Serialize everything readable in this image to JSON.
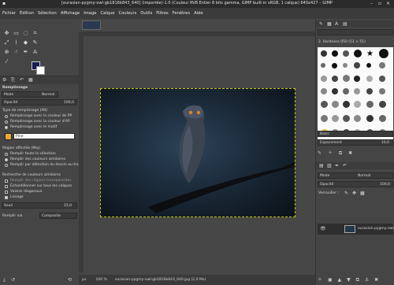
{
  "window": {
    "title": "[eurasian-pygmy-owl-gb1816b843_640] (importée)-1.0 (Couleur RVB Entier 8 bits gamma, GIMP built-in sRGB, 1 calque) 640x427 – GIMP"
  },
  "menu": [
    "Fichier",
    "Édition",
    "Sélection",
    "Affichage",
    "Image",
    "Calque",
    "Couleurs",
    "Outils",
    "Filtres",
    "Fenêtres",
    "Aide"
  ],
  "tool_options": {
    "title": "Remplissage",
    "mode_label": "Mode",
    "mode_value": "Normal",
    "opacity_label": "Opacité",
    "opacity_value": "100,0",
    "fill_type_label": "Type de remplissage (Alt)",
    "fill_fg": "Remplissage avec la couleur de PP",
    "fill_bg": "Remplissage avec la couleur d'AP",
    "fill_pattern": "Remplissage avec le motif",
    "pattern_name": "Pine",
    "affected_label": "Région affectée (Maj)",
    "aff_selection": "Remplir toute la sélection",
    "aff_similar": "Remplir des couleurs similaires",
    "aff_lineart": "Remplir par détection du dessin au trait",
    "similar_label": "Recherche de couleurs similaires",
    "sim_transparent": "Remplir des régions transparentes",
    "sim_merged": "Échantillonner sur tous les calques",
    "sim_diagonal": "Voisins diagonaux",
    "sim_antialias": "Lissage",
    "threshold_label": "Seuil",
    "threshold_value": "15,0",
    "fillby_label": "Remplir via",
    "fillby_value": "Composite"
  },
  "status": {
    "unit": "px",
    "zoom": "100 %",
    "info": "eurasian-pygmy-owl-gb1816b843_640.jpg (2,0 Mo)"
  },
  "brushes": {
    "title": "2. Hardness 050 (51 × 51)",
    "tag": "Basic",
    "spacing_label": "Espacement",
    "spacing_value": "10,0"
  },
  "layers": {
    "mode_label": "Mode",
    "mode_value": "Normal",
    "opacity_label": "Opacité",
    "opacity_value": "100,0",
    "lock_label": "Verrouiller :",
    "layer_name": "eurasian-pygmy-owl"
  },
  "colors": {
    "foreground": "#1a1a5a",
    "background": "#ffffff",
    "pattern_swatch": "#f0a830",
    "selection_border": "#c8c800"
  }
}
